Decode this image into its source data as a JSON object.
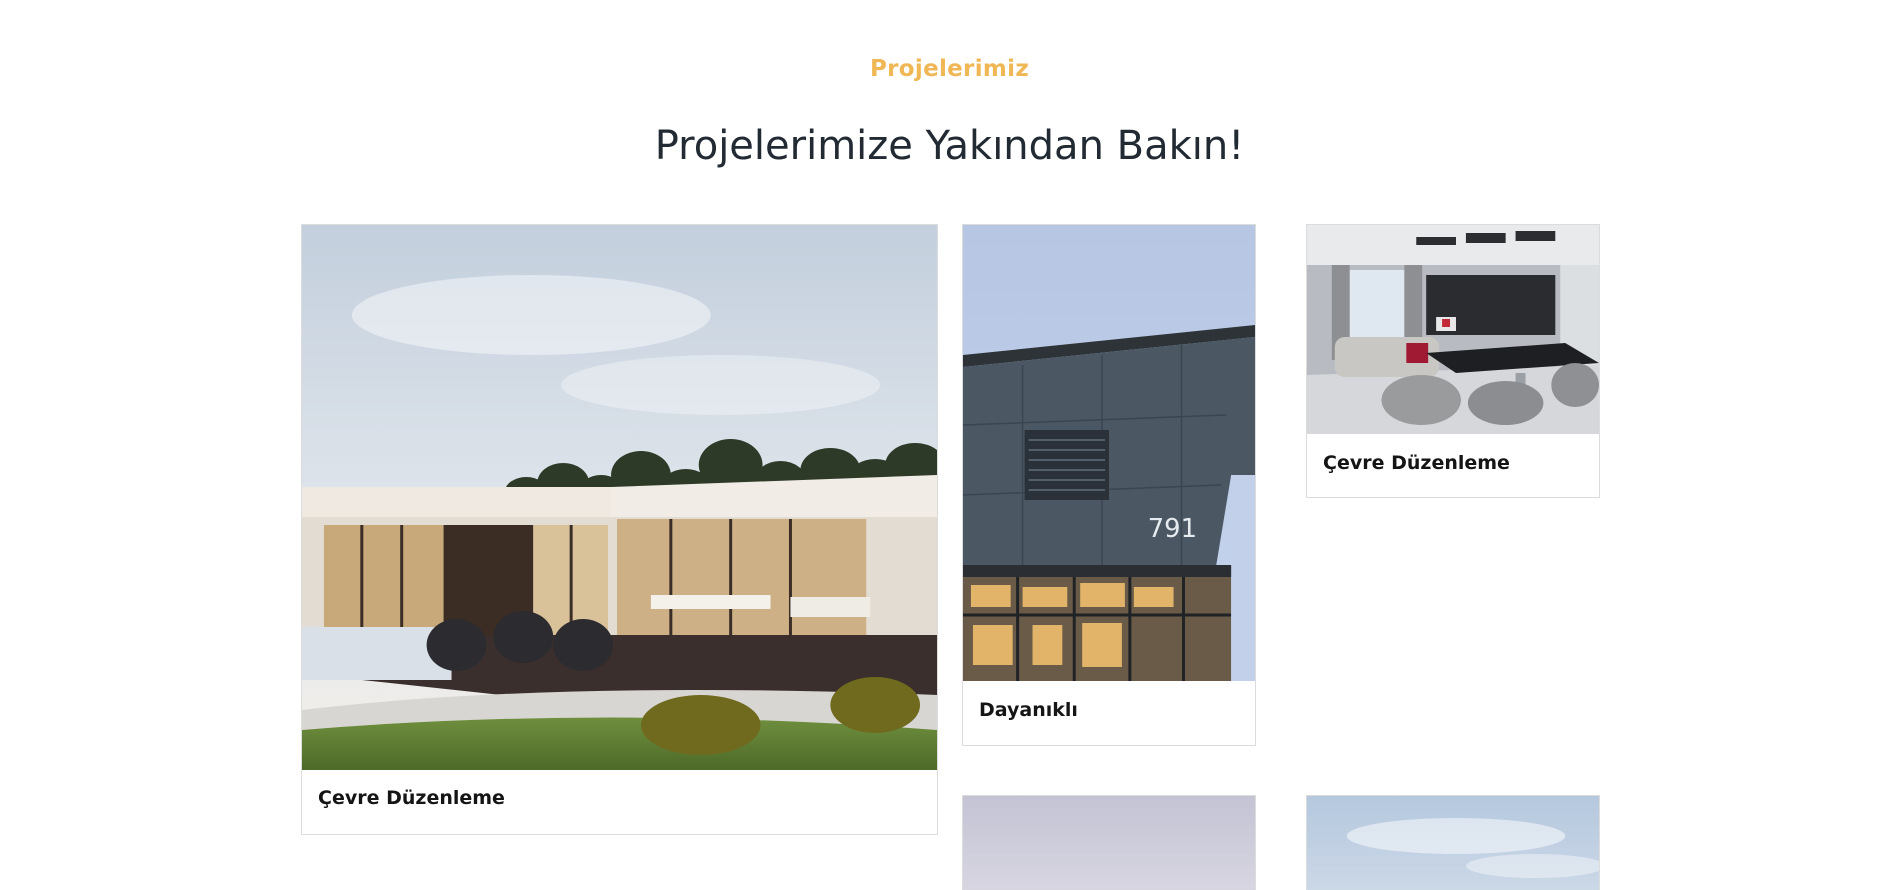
{
  "section": {
    "eyebrow": "Projelerimiz",
    "title": "Projelerimize Yakından Bakın!"
  },
  "projects": [
    {
      "caption": "Çevre Düzenleme",
      "image_icon": "modern-house-garden-image"
    },
    {
      "caption": "Dayanıklı",
      "image_icon": "building-facade-image",
      "building_number": "791"
    },
    {
      "caption": "Çevre Düzenleme",
      "image_icon": "living-room-interior-image"
    },
    {
      "caption": "",
      "image_icon": "building-photo-image"
    },
    {
      "caption": "",
      "image_icon": "sky-photo-image"
    }
  ],
  "colors": {
    "accent": "#f0b755",
    "heading": "#222a33",
    "card_border": "#dcdcdc"
  }
}
